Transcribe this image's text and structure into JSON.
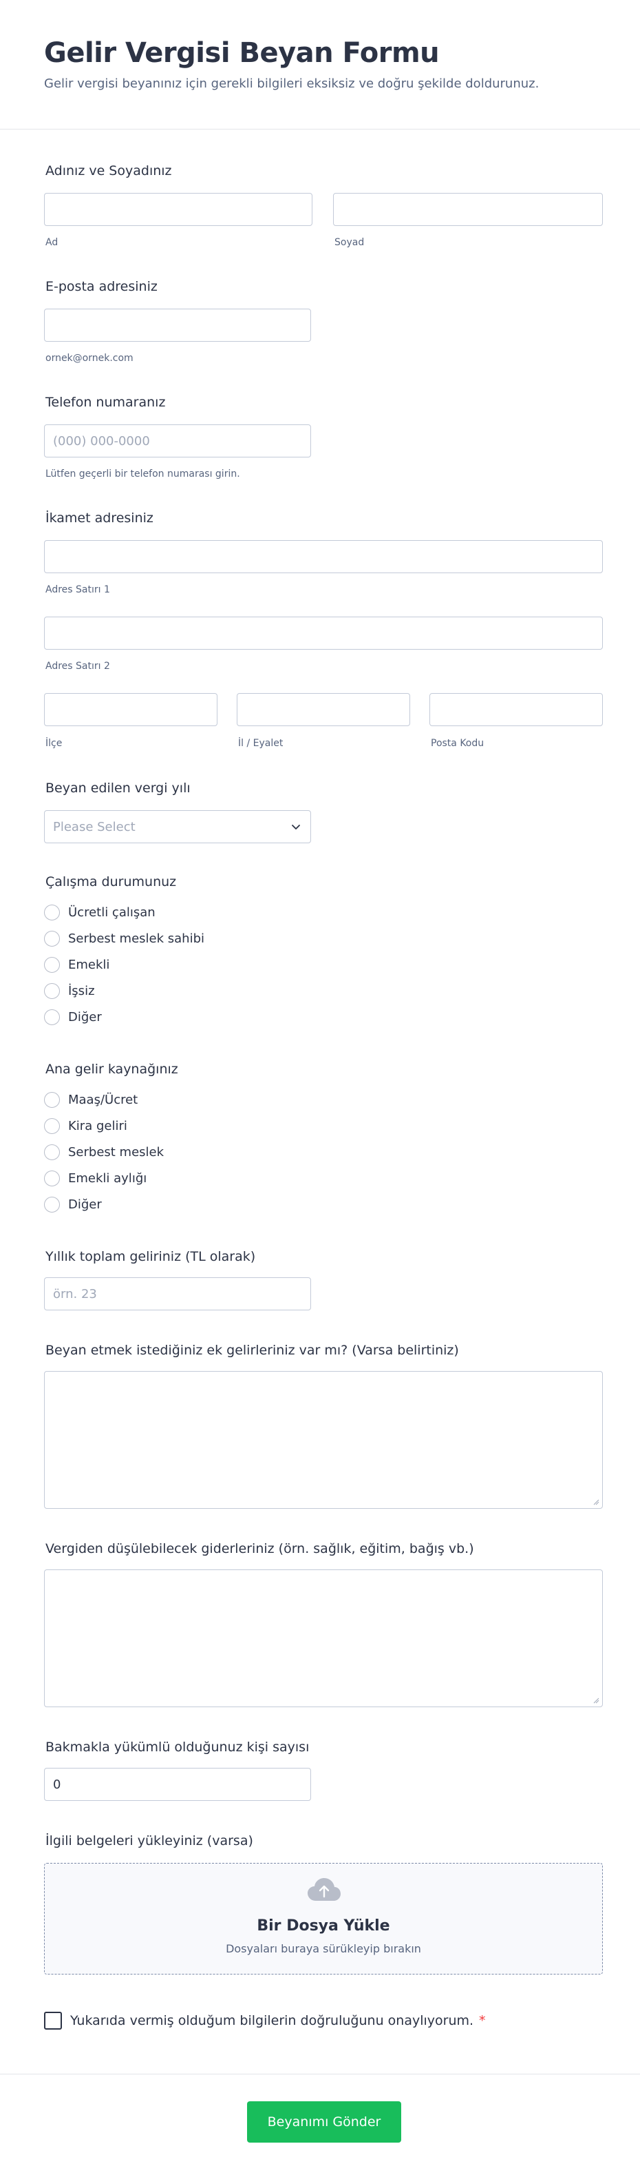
{
  "header": {
    "title": "Gelir Vergisi Beyan Formu",
    "description": "Gelir vergisi beyanınız için gerekli bilgileri eksiksiz ve doğru şekilde doldurunuz."
  },
  "name": {
    "label": "Adınız ve Soyadınız",
    "first_sublabel": "Ad",
    "last_sublabel": "Soyad"
  },
  "email": {
    "label": "E-posta adresiniz",
    "sublabel": "ornek@ornek.com"
  },
  "phone": {
    "label": "Telefon numaranız",
    "placeholder": "(000) 000-0000",
    "sublabel": "Lütfen geçerli bir telefon numarası girin."
  },
  "address": {
    "label": "İkamet adresiniz",
    "line1_sublabel": "Adres Satırı 1",
    "line2_sublabel": "Adres Satırı 2",
    "district_sublabel": "İlçe",
    "province_sublabel": "İl / Eyalet",
    "postal_sublabel": "Posta Kodu"
  },
  "tax_year": {
    "label": "Beyan edilen vergi yılı",
    "placeholder": "Please Select"
  },
  "employment": {
    "label": "Çalışma durumunuz",
    "options": [
      "Ücretli çalışan",
      "Serbest meslek sahibi",
      "Emekli",
      "İşsiz",
      "Diğer"
    ]
  },
  "income_source": {
    "label": "Ana gelir kaynağınız",
    "options": [
      "Maaş/Ücret",
      "Kira geliri",
      "Serbest meslek",
      "Emekli aylığı",
      "Diğer"
    ]
  },
  "annual_income": {
    "label": "Yıllık toplam geliriniz (TL olarak)",
    "placeholder": "örn. 23"
  },
  "extra_income": {
    "label": "Beyan etmek istediğiniz ek gelirleriniz var mı? (Varsa belirtiniz)"
  },
  "deductions": {
    "label": "Vergiden düşülebilecek giderleriniz (örn. sağlık, eğitim, bağış vb.)"
  },
  "dependents": {
    "label": "Bakmakla yükümlü olduğunuz kişi sayısı",
    "value": "0"
  },
  "upload": {
    "label": "İlgili belgeleri yükleyiniz (varsa)",
    "title": "Bir Dosya Yükle",
    "subtitle": "Dosyaları buraya sürükleyip bırakın"
  },
  "consent": {
    "label": "Yukarıda vermiş olduğum bilgilerin doğruluğunu onaylıyorum.",
    "required_mark": "*"
  },
  "submit": {
    "label": "Beyanımı Gönder"
  },
  "colors": {
    "submit": "#18bd5b",
    "required": "#f23a3c",
    "text": "#2c3345"
  }
}
